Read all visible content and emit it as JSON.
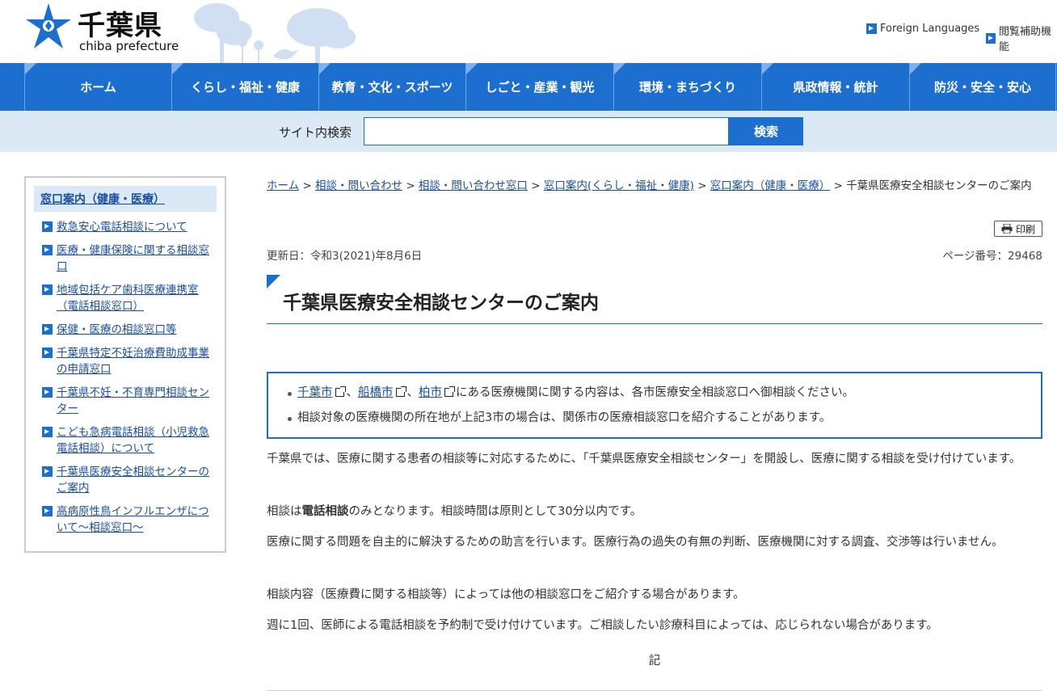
{
  "header": {
    "logo_title": "千葉県",
    "logo_subtitle": "chiba prefecture",
    "links": [
      {
        "label": "Foreign Languages"
      },
      {
        "label": "閲覧補助機能"
      }
    ]
  },
  "gnav": {
    "items": [
      {
        "label": "ホーム"
      },
      {
        "label": "くらし・福祉・健康"
      },
      {
        "label": "教育・文化・スポーツ"
      },
      {
        "label": "しごと・産業・観光"
      },
      {
        "label": "環境・まちづくり"
      },
      {
        "label": "県政情報・統計"
      },
      {
        "label": "防災・安全・安心"
      }
    ]
  },
  "search": {
    "label": "サイト内検索",
    "value": "",
    "placeholder": "",
    "button_label": "検索"
  },
  "sidebar": {
    "heading": "窓口案内（健康・医療）",
    "items": [
      {
        "label": "救急安心電話相談について"
      },
      {
        "label": "医療・健康保険に関する相談窓口"
      },
      {
        "label": "地域包括ケア歯科医療連携室（電話相談窓口）"
      },
      {
        "label": "保健・医療の相談窓口等"
      },
      {
        "label": "千葉県特定不妊治療費助成事業の申請窓口"
      },
      {
        "label": "千葉県不妊・不育専門相談センター"
      },
      {
        "label": "こども急病電話相談（小児救急電話相談）について"
      },
      {
        "label": "千葉県医療安全相談センターのご案内"
      },
      {
        "label": "高病原性鳥インフルエンザについて～相談窓口～"
      }
    ]
  },
  "breadcrumb": {
    "links": [
      {
        "label": "ホーム"
      },
      {
        "label": "相談・問い合わせ"
      },
      {
        "label": "相談・問い合わせ窓口"
      },
      {
        "label": "窓口案内(くらし・福祉・健康)"
      },
      {
        "label": "窓口案内（健康・医療）"
      }
    ],
    "separator": ">",
    "current": "千葉県医療安全相談センターのご案内"
  },
  "print_label": "印刷",
  "updated": "更新日：令和3(2021)年8月6日",
  "page_number": "ページ番号：29468",
  "page_title": "千葉県医療安全相談センターのご案内",
  "notice": {
    "cities": [
      "千葉市",
      "船橋市",
      "柏市"
    ],
    "sep": "、",
    "line1_suffix": "にある医療機関に関する内容は、各市医療安全相談窓口へ御相談ください。",
    "line2": "相談対象の医療機関の所在地が上記3市の場合は、関係市の医療相談窓口を紹介することがあります。"
  },
  "paragraphs": [
    {
      "text": "千葉県では、医療に関する患者の相談等に対応するために、「千葉県医療安全相談センター」を開設し、医療に関する相談を受け付けています。"
    },
    {
      "prefix": "相談は",
      "bold": "電話相談",
      "suffix": "のみとなります。相談時間は原則として30分以内です。"
    },
    {
      "text": "医療に関する問題を自主的に解決するための助言を行います。医療行為の過失の有無の判断、医療機関に対する調査、交渉等は行いません。"
    },
    {
      "text": "相談内容（医療費に関する相談等）によっては他の相談窓口をご紹介する場合があります。"
    },
    {
      "text": "週に1回、医師による電話相談を予約制で受け付けています。ご相談したい診療科目によっては、応じられない場合があります。"
    }
  ],
  "ki": "記",
  "colors": {
    "accent": "#1d6fcf",
    "link": "#1a4fa0",
    "light": "#dbe9f7"
  }
}
